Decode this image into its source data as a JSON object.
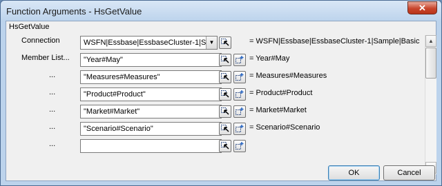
{
  "window": {
    "title": "Function Arguments - HsGetValue",
    "close_symbol": "✕"
  },
  "group": {
    "label": "HsGetValue"
  },
  "rows": [
    {
      "label": "Connection",
      "value": "WSFN|Essbase|EssbaseCluster-1|Sample|Basic",
      "result": "= WSFN|Essbase|EssbaseCluster-1|Sample|Basic"
    },
    {
      "label": "Member List...",
      "value": "\"Year#May\"",
      "result": "= Year#May"
    },
    {
      "label": "...",
      "value": "\"Measures#Measures\"",
      "result": "= Measures#Measures"
    },
    {
      "label": "...",
      "value": "\"Product#Product\"",
      "result": "= Product#Product"
    },
    {
      "label": "...",
      "value": "\"Market#Market\"",
      "result": "= Market#Market"
    },
    {
      "label": "...",
      "value": "\"Scenario#Scenario\"",
      "result": "= Scenario#Scenario"
    },
    {
      "label": "...",
      "value": "",
      "result": ""
    }
  ],
  "icons": {
    "select_member": "select-member-icon",
    "add_member": "add-member-icon",
    "dropdown": "▼",
    "scroll_up": "▲",
    "scroll_down": "▼"
  },
  "buttons": {
    "ok": "OK",
    "cancel": "Cancel"
  }
}
